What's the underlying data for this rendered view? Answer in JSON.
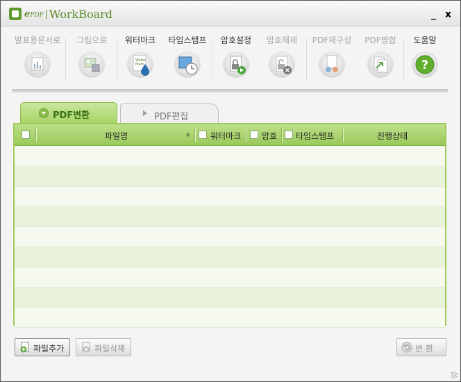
{
  "app": {
    "logo_e": "e",
    "logo_pdf": "PDF",
    "logo_name": "WorkBoard",
    "minimize_glyph": "_",
    "close_glyph": "x"
  },
  "toolbar": [
    {
      "label": "발표용문서로",
      "icon": "presentation-chart-icon",
      "enabled": false
    },
    {
      "label": "그림으로",
      "icon": "image-save-icon",
      "enabled": false
    },
    {
      "label": "워터마크",
      "icon": "watermark-drop-icon",
      "enabled": true,
      "icon_text_1": "Water",
      "icon_text_2": "Mark"
    },
    {
      "label": "타임스탬프",
      "icon": "timestamp-clock-icon",
      "enabled": true
    },
    {
      "label": "암호설정",
      "icon": "lock-document-icon",
      "enabled": true
    },
    {
      "label": "암호해제",
      "icon": "unlock-document-icon",
      "enabled": false
    },
    {
      "label": "PDF재구성",
      "icon": "pdf-reorganize-icon",
      "enabled": false
    },
    {
      "label": "PDF병합",
      "icon": "pdf-merge-icon",
      "enabled": false
    },
    {
      "label": "도움말",
      "icon": "help-icon",
      "enabled": true,
      "icon_text_1": "?"
    }
  ],
  "tabs": [
    {
      "label": "PDF변환",
      "active": true
    },
    {
      "label": "PDF편집",
      "active": false
    }
  ],
  "grid": {
    "col_filename": "파일명",
    "col_watermark": "워터마크",
    "col_password": "암호",
    "col_timestamp": "타임스탬프",
    "col_status": "진행상태",
    "row_count": 9
  },
  "buttons": {
    "add_file": "파일추가",
    "delete_file": "파일삭제",
    "convert": "변 환"
  },
  "colors": {
    "accent_green": "#9dcb5b",
    "tab_text": "#3a6e12",
    "disabled_text": "#a6a6a6"
  }
}
